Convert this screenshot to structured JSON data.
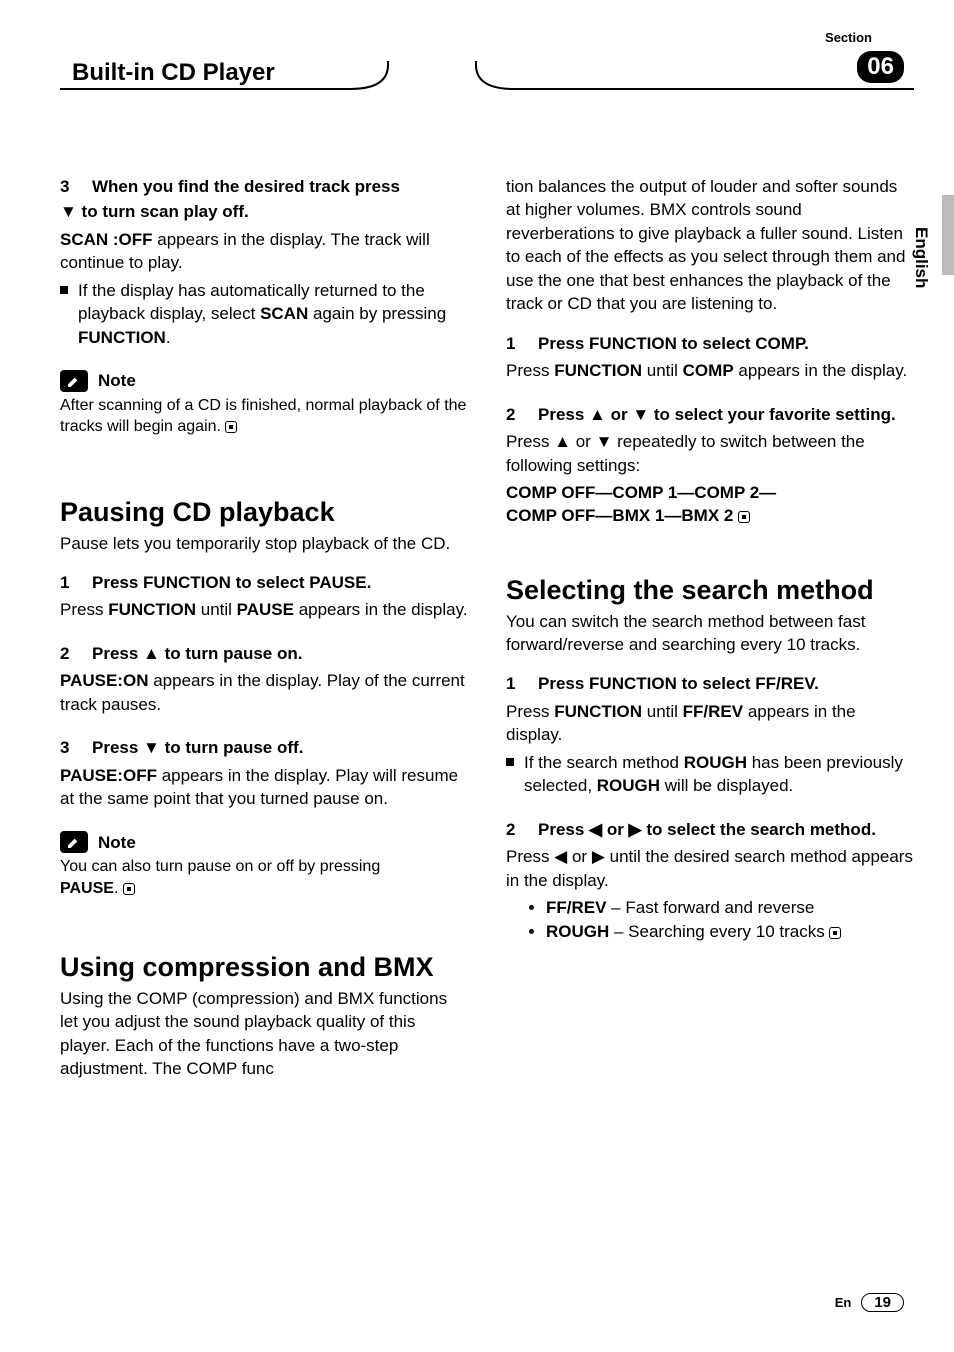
{
  "header": {
    "section_label": "Section",
    "chapter_title": "Built-in CD Player",
    "chapter_number": "06",
    "language": "English"
  },
  "left": {
    "scan": {
      "step3_lead_a": "When you find the desired track press",
      "step3_lead_b": "▼ to turn scan play off.",
      "l1": "SCAN :OFF",
      "l1b": " appears in the display. The track will continue to play.",
      "bullet": "If the display has automatically returned to the playback display, select ",
      "bullet_b": "SCAN",
      "bullet_c": " again by pressing ",
      "bullet_d": "FUNCTION",
      "note_label": "Note",
      "note_body": "After scanning of a CD is finished, normal playback of the tracks will begin again."
    },
    "pause": {
      "title": "Pausing CD playback",
      "intro": "Pause lets you temporarily stop playback of the CD.",
      "s1_lead": "Press FUNCTION to select PAUSE.",
      "s1_body_a": "Press ",
      "s1_body_b": "FUNCTION",
      "s1_body_c": " until ",
      "s1_body_d": "PAUSE",
      "s1_body_e": " appears in the display.",
      "s2_lead": "Press ▲ to turn pause on.",
      "s2_body_a": "PAUSE:ON",
      "s2_body_b": " appears in the display. Play of the current track pauses.",
      "s3_lead": "Press ▼ to turn pause off.",
      "s3_body_a": "PAUSE:OFF",
      "s3_body_b": " appears in the display. Play will resume at the same point that you turned pause on.",
      "note_label": "Note",
      "note_body_a": "You can also turn pause on or off by pressing ",
      "note_body_b": "PAUSE"
    },
    "comp": {
      "title": "Using compression and BMX",
      "intro": "Using the COMP (compression) and BMX functions let you adjust the sound playback quality of this player. Each of the functions have a two-step adjustment. The COMP func"
    }
  },
  "right": {
    "comp": {
      "cont": "tion balances the output of louder and softer sounds at higher volumes. BMX controls sound reverberations to give playback a fuller sound. Listen to each of the effects as you select through them and use the one that best enhances the playback of the track or CD that you are listening to.",
      "s1_lead": "Press FUNCTION to select COMP.",
      "s1_body_a": "Press ",
      "s1_body_b": "FUNCTION",
      "s1_body_c": " until ",
      "s1_body_d": "COMP",
      "s1_body_e": " appears in the display.",
      "s2_lead": "Press ▲ or ▼ to select your favorite setting.",
      "s2_body": "Press ▲ or ▼ repeatedly to switch between the following settings:",
      "settings_a": "COMP OFF",
      "settings_b": "COMP 1",
      "settings_c": "COMP 2",
      "settings_d": "COMP OFF",
      "settings_e": "BMX 1",
      "settings_f": "BMX 2"
    },
    "search": {
      "title": "Selecting the search method",
      "intro": "You can switch the search method between fast forward/reverse and searching every 10 tracks.",
      "s1_lead": "Press FUNCTION to select FF/REV.",
      "s1_body_a": "Press ",
      "s1_body_b": "FUNCTION",
      "s1_body_c": " until ",
      "s1_body_d": "FF/REV",
      "s1_body_e": " appears in the display.",
      "s1_bullet_a": "If the search method ",
      "s1_bullet_b": "ROUGH",
      "s1_bullet_c": " has been previously selected, ",
      "s1_bullet_d": "ROUGH",
      "s1_bullet_e": " will be displayed.",
      "s2_lead": "Press ◀ or ▶ to select the search method.",
      "s2_body": "Press ◀ or ▶ until the desired search method appears in the display.",
      "li1_a": "FF/REV",
      "li1_b": " – Fast forward and reverse",
      "li2_a": "ROUGH",
      "li2_b": " – Searching every 10 tracks"
    }
  },
  "footer": {
    "lang_code": "En",
    "page_num": "19"
  }
}
